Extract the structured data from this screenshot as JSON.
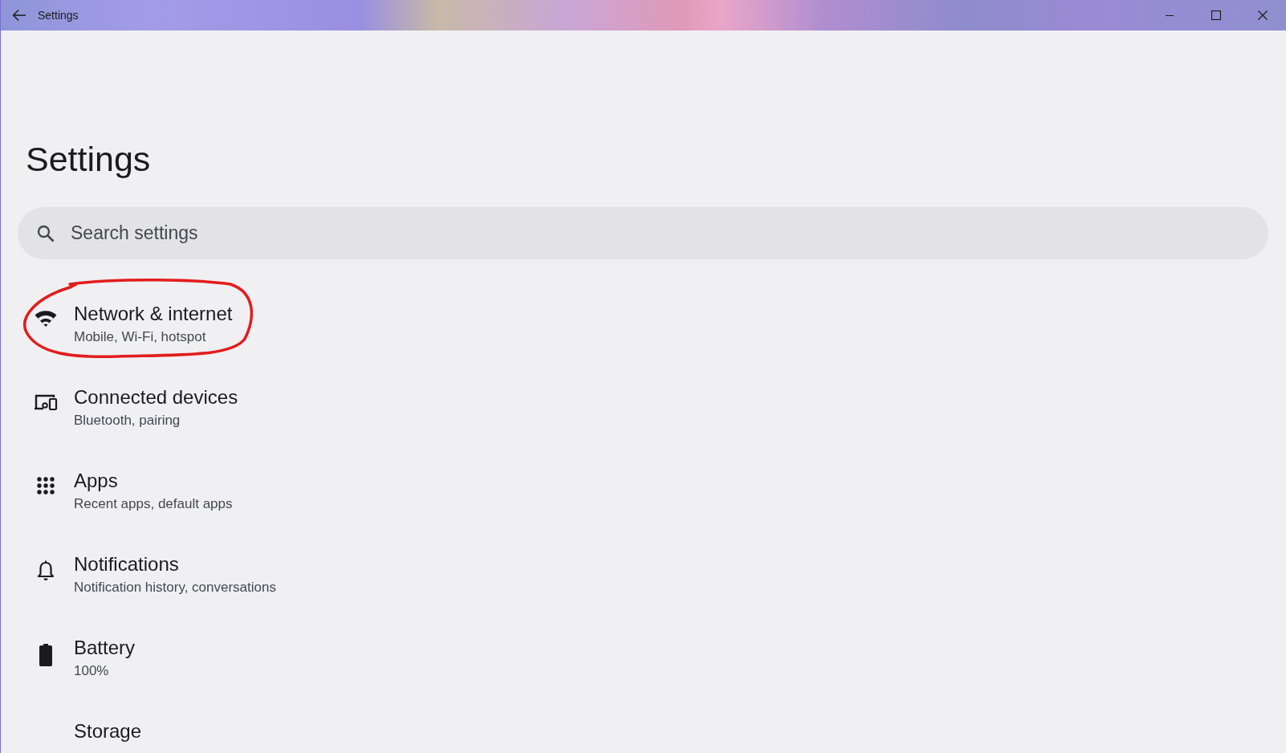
{
  "window": {
    "title": "Settings"
  },
  "page": {
    "heading": "Settings"
  },
  "search": {
    "placeholder": "Search settings"
  },
  "items": [
    {
      "kind": "wifi",
      "title": "Network & internet",
      "subtitle": "Mobile, Wi-Fi, hotspot",
      "circled": true
    },
    {
      "kind": "devices",
      "title": "Connected devices",
      "subtitle": "Bluetooth, pairing",
      "circled": false
    },
    {
      "kind": "apps",
      "title": "Apps",
      "subtitle": "Recent apps, default apps",
      "circled": false
    },
    {
      "kind": "bell",
      "title": "Notifications",
      "subtitle": "Notification history, conversations",
      "circled": false
    },
    {
      "kind": "battery",
      "title": "Battery",
      "subtitle": "100%",
      "circled": false
    },
    {
      "kind": "storage",
      "title": "Storage",
      "circled": false
    }
  ]
}
